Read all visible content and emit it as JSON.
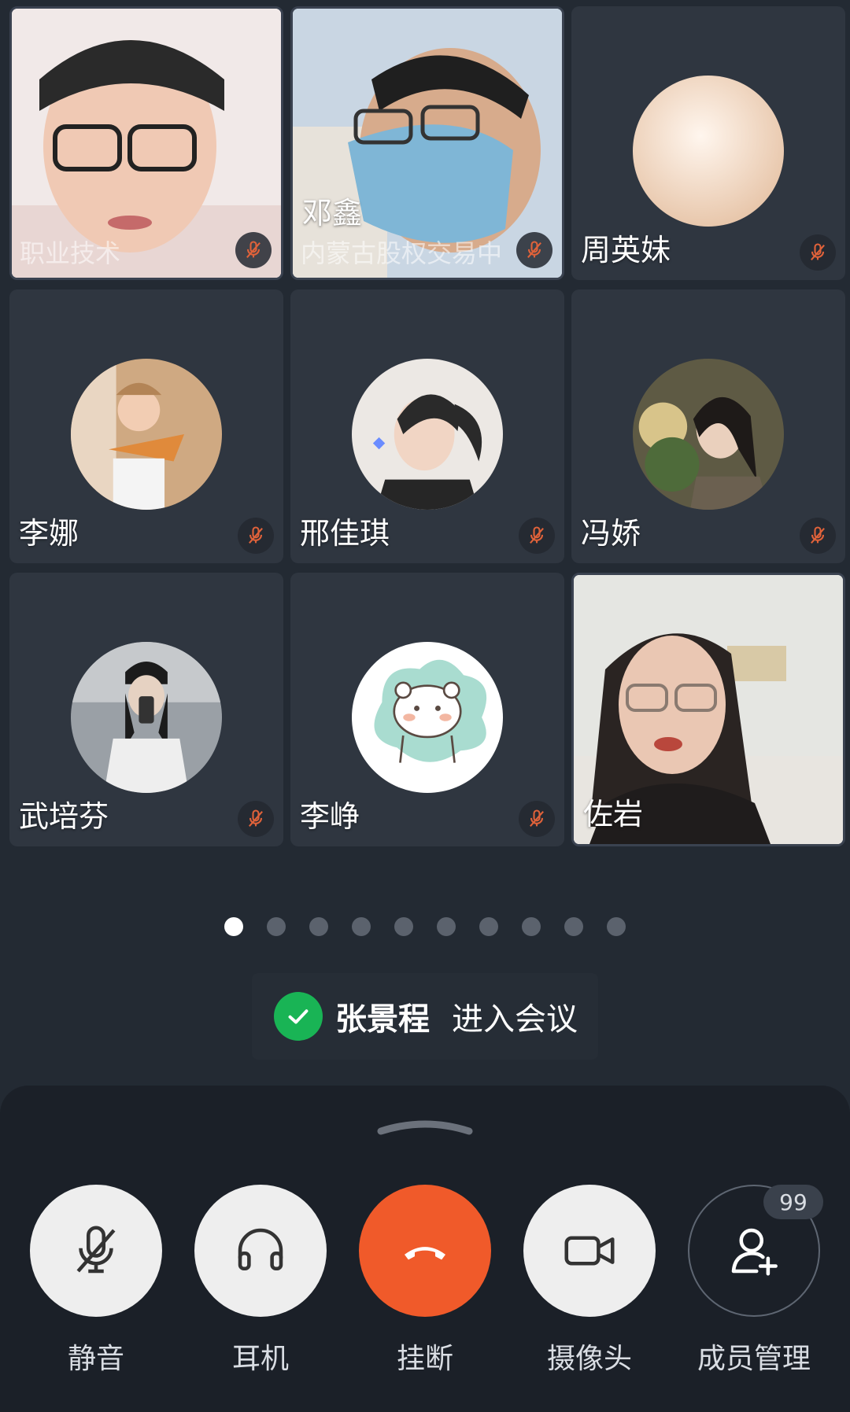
{
  "participants": [
    {
      "name": "",
      "subtitle": "职业技术",
      "type": "video",
      "muted": true
    },
    {
      "name": "邓鑫",
      "subtitle": "内蒙古股权交易中",
      "type": "video",
      "muted": true
    },
    {
      "name": "周英妹",
      "type": "avatar",
      "muted": true
    },
    {
      "name": "李娜",
      "type": "avatar",
      "muted": true
    },
    {
      "name": "邢佳琪",
      "type": "avatar",
      "muted": true
    },
    {
      "name": "冯娇",
      "type": "avatar",
      "muted": true
    },
    {
      "name": "武培芬",
      "type": "avatar",
      "muted": true
    },
    {
      "name": "李峥",
      "type": "avatar",
      "muted": true
    },
    {
      "name": "佐岩",
      "type": "video",
      "muted": false
    }
  ],
  "pager": {
    "total": 10,
    "active": 0
  },
  "toast": {
    "name": "张景程",
    "message": "进入会议"
  },
  "controls": {
    "mute_label": "静音",
    "headset_label": "耳机",
    "hangup_label": "挂断",
    "camera_label": "摄像头",
    "members_label": "成员管理",
    "member_count": "99"
  },
  "colors": {
    "background": "#232a33",
    "tile": "#2f3640",
    "hangup": "#f05a2a",
    "toast_check": "#19b455",
    "muted_icon": "#e0623a"
  }
}
